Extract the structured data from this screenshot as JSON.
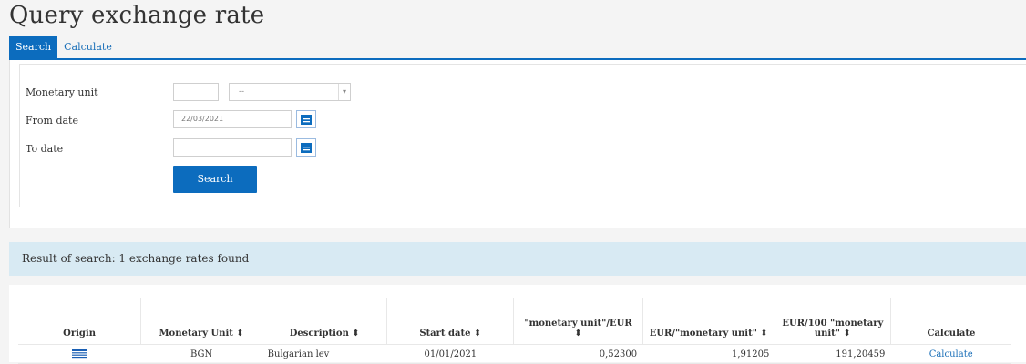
{
  "page": {
    "title": "Query exchange rate"
  },
  "tabs": [
    {
      "label": "Search",
      "active": true
    },
    {
      "label": "Calculate",
      "active": false
    }
  ],
  "form": {
    "monetary_unit_label": "Monetary unit",
    "monetary_unit_value": "",
    "monetary_unit_select": "--",
    "from_date_label": "From date",
    "from_date_value": "22/03/2021",
    "to_date_label": "To date",
    "to_date_value": "",
    "search_button": "Search"
  },
  "results": {
    "summary": "Result of search: 1 exchange rates found",
    "columns": [
      "Origin",
      "Monetary Unit ⬍",
      "Description ⬍",
      "Start date ⬍",
      "\"monetary unit\"/EUR ⬍",
      "EUR/\"monetary unit\" ⬍",
      "EUR/100 \"monetary unit\" ⬍",
      "Calculate"
    ],
    "rows": [
      {
        "origin_icon": "flag-icon",
        "monetary_unit": "BGN",
        "description": "Bulgarian lev",
        "start_date": "01/01/2021",
        "unit_per_eur": "0,52300",
        "eur_per_unit": "1,91205",
        "eur_per_100_units": "191,20459",
        "calculate_link": "Calculate"
      }
    ]
  },
  "colors": {
    "accent": "#0c6cbe",
    "link": "#1a6fb8",
    "banner": "#d8eaf3"
  }
}
